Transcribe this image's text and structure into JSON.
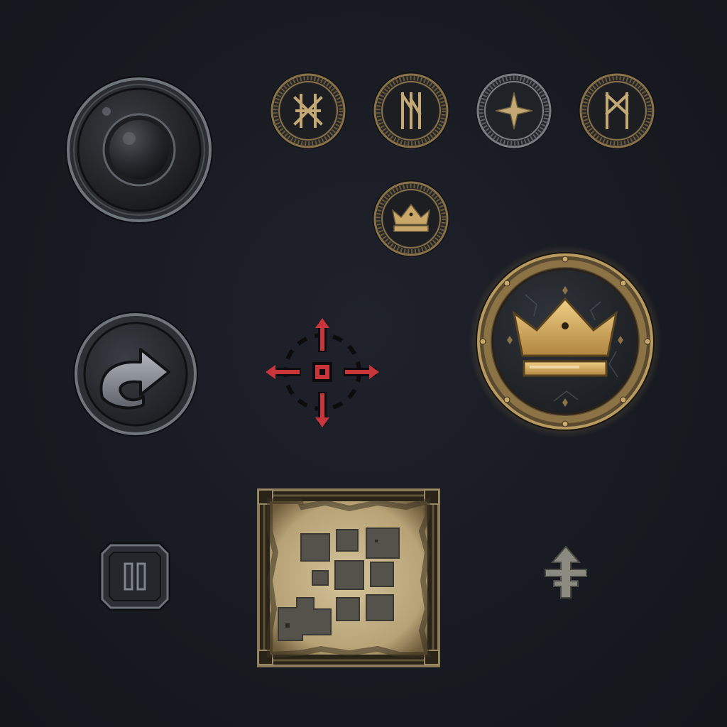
{
  "palette": {
    "background": "#1a1c23",
    "iron_dark": "#2a2d31",
    "iron_light": "#6e757b",
    "bronze": "#8a7248",
    "gold": "#d2a85a",
    "crosshair_red": "#c8353a",
    "parchment": "#c9b58a",
    "minimap_tile": "#55524b"
  },
  "icons": {
    "joystick": "joystick-knob-icon",
    "runes": [
      "algiz-bind-rune-icon",
      "rune-n-icon",
      "four-point-star-icon",
      "rune-m-icon"
    ],
    "crown_small": "crown-icon",
    "crown_large": "crown-icon",
    "redo": "curved-arrow-icon",
    "crosshair": "crosshair-icon",
    "pause": "pause-icon",
    "minimap": "dungeon-map-icon",
    "waypoint": "arrow-up-marker-icon"
  },
  "state": {
    "selected_button": "crown-large"
  }
}
